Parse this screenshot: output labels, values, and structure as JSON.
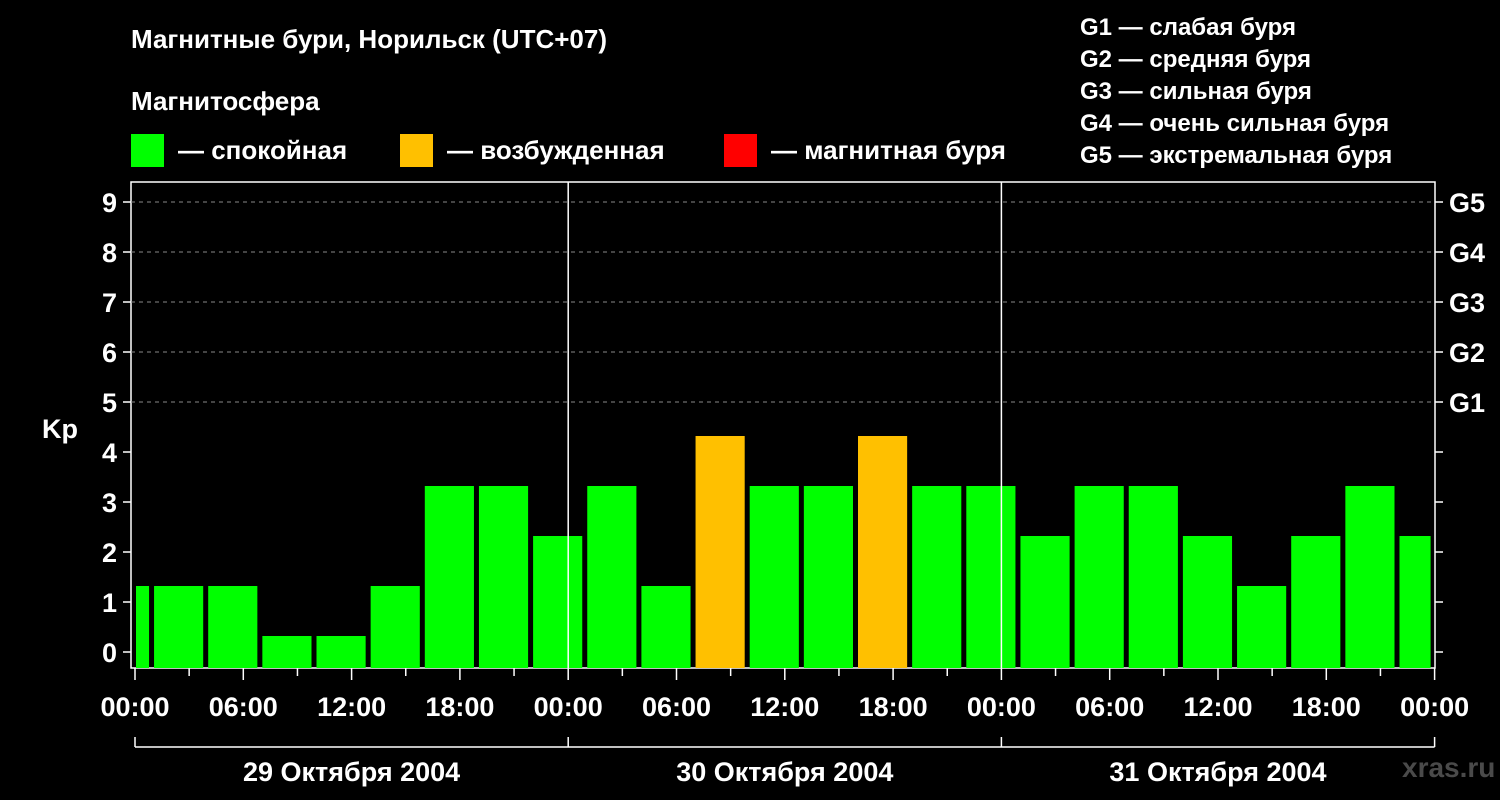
{
  "header": {
    "title": "Магнитные бури, Норильск (UTC+07)",
    "subtitle": "Магнитосфера"
  },
  "legend": [
    {
      "label": "— спокойная",
      "color": "#00ff00"
    },
    {
      "label": "— возбужденная",
      "color": "#ffc000"
    },
    {
      "label": "— магнитная буря",
      "color": "#ff0000"
    }
  ],
  "g_legend": [
    "G1 — слабая буря",
    "G2 — средняя буря",
    "G3 — сильная буря",
    "G4 — очень сильная буря",
    "G5 — экстремальная буря"
  ],
  "watermark": "xras.ru",
  "chart_data": {
    "type": "bar",
    "ylabel": "Kp",
    "ylim": [
      0,
      9
    ],
    "yticks": [
      "0",
      "1",
      "2",
      "3",
      "4",
      "5",
      "6",
      "7",
      "8",
      "9"
    ],
    "right_labels": [
      {
        "kp": 5,
        "label": "G1"
      },
      {
        "kp": 6,
        "label": "G2"
      },
      {
        "kp": 7,
        "label": "G3"
      },
      {
        "kp": 8,
        "label": "G4"
      },
      {
        "kp": 9,
        "label": "G5"
      }
    ],
    "grid": "dashed at Kp 5-9",
    "x_range_hours": [
      0,
      72
    ],
    "xticks": [
      {
        "h": 0,
        "label": "00:00"
      },
      {
        "h": 6,
        "label": "06:00"
      },
      {
        "h": 12,
        "label": "12:00"
      },
      {
        "h": 18,
        "label": "18:00"
      },
      {
        "h": 24,
        "label": "00:00"
      },
      {
        "h": 30,
        "label": "06:00"
      },
      {
        "h": 36,
        "label": "12:00"
      },
      {
        "h": 42,
        "label": "18:00"
      },
      {
        "h": 48,
        "label": "00:00"
      },
      {
        "h": 54,
        "label": "06:00"
      },
      {
        "h": 60,
        "label": "12:00"
      },
      {
        "h": 66,
        "label": "18:00"
      },
      {
        "h": 72,
        "label": "00:00"
      }
    ],
    "day_dividers_h": [
      24,
      48
    ],
    "days": [
      {
        "start_h": 0,
        "end_h": 24,
        "label": "29 Октября 2004"
      },
      {
        "start_h": 24,
        "end_h": 48,
        "label": "30 Октября 2004"
      },
      {
        "start_h": 48,
        "end_h": 72,
        "label": "31 Октября 2004"
      }
    ],
    "bars": [
      {
        "start_h": 0,
        "end_h": 1,
        "kp": 1,
        "color": "#00ff00"
      },
      {
        "start_h": 1,
        "end_h": 4,
        "kp": 1,
        "color": "#00ff00"
      },
      {
        "start_h": 4,
        "end_h": 7,
        "kp": 1,
        "color": "#00ff00"
      },
      {
        "start_h": 7,
        "end_h": 10,
        "kp": 0,
        "color": "#00ff00"
      },
      {
        "start_h": 10,
        "end_h": 13,
        "kp": 0,
        "color": "#00ff00"
      },
      {
        "start_h": 13,
        "end_h": 16,
        "kp": 1,
        "color": "#00ff00"
      },
      {
        "start_h": 16,
        "end_h": 19,
        "kp": 3,
        "color": "#00ff00"
      },
      {
        "start_h": 19,
        "end_h": 22,
        "kp": 3,
        "color": "#00ff00"
      },
      {
        "start_h": 22,
        "end_h": 25,
        "kp": 2,
        "color": "#00ff00"
      },
      {
        "start_h": 25,
        "end_h": 28,
        "kp": 3,
        "color": "#00ff00"
      },
      {
        "start_h": 28,
        "end_h": 31,
        "kp": 1,
        "color": "#00ff00"
      },
      {
        "start_h": 31,
        "end_h": 34,
        "kp": 4,
        "color": "#ffc000"
      },
      {
        "start_h": 34,
        "end_h": 37,
        "kp": 3,
        "color": "#00ff00"
      },
      {
        "start_h": 37,
        "end_h": 40,
        "kp": 3,
        "color": "#00ff00"
      },
      {
        "start_h": 40,
        "end_h": 43,
        "kp": 4,
        "color": "#ffc000"
      },
      {
        "start_h": 43,
        "end_h": 46,
        "kp": 3,
        "color": "#00ff00"
      },
      {
        "start_h": 46,
        "end_h": 49,
        "kp": 3,
        "color": "#00ff00"
      },
      {
        "start_h": 49,
        "end_h": 52,
        "kp": 2,
        "color": "#00ff00"
      },
      {
        "start_h": 52,
        "end_h": 55,
        "kp": 3,
        "color": "#00ff00"
      },
      {
        "start_h": 55,
        "end_h": 58,
        "kp": 3,
        "color": "#00ff00"
      },
      {
        "start_h": 58,
        "end_h": 61,
        "kp": 2,
        "color": "#00ff00"
      },
      {
        "start_h": 61,
        "end_h": 64,
        "kp": 1,
        "color": "#00ff00"
      },
      {
        "start_h": 64,
        "end_h": 67,
        "kp": 2,
        "color": "#00ff00"
      },
      {
        "start_h": 67,
        "end_h": 70,
        "kp": 3,
        "color": "#00ff00"
      },
      {
        "start_h": 70,
        "end_h": 72,
        "kp": 2,
        "color": "#00ff00"
      }
    ]
  }
}
